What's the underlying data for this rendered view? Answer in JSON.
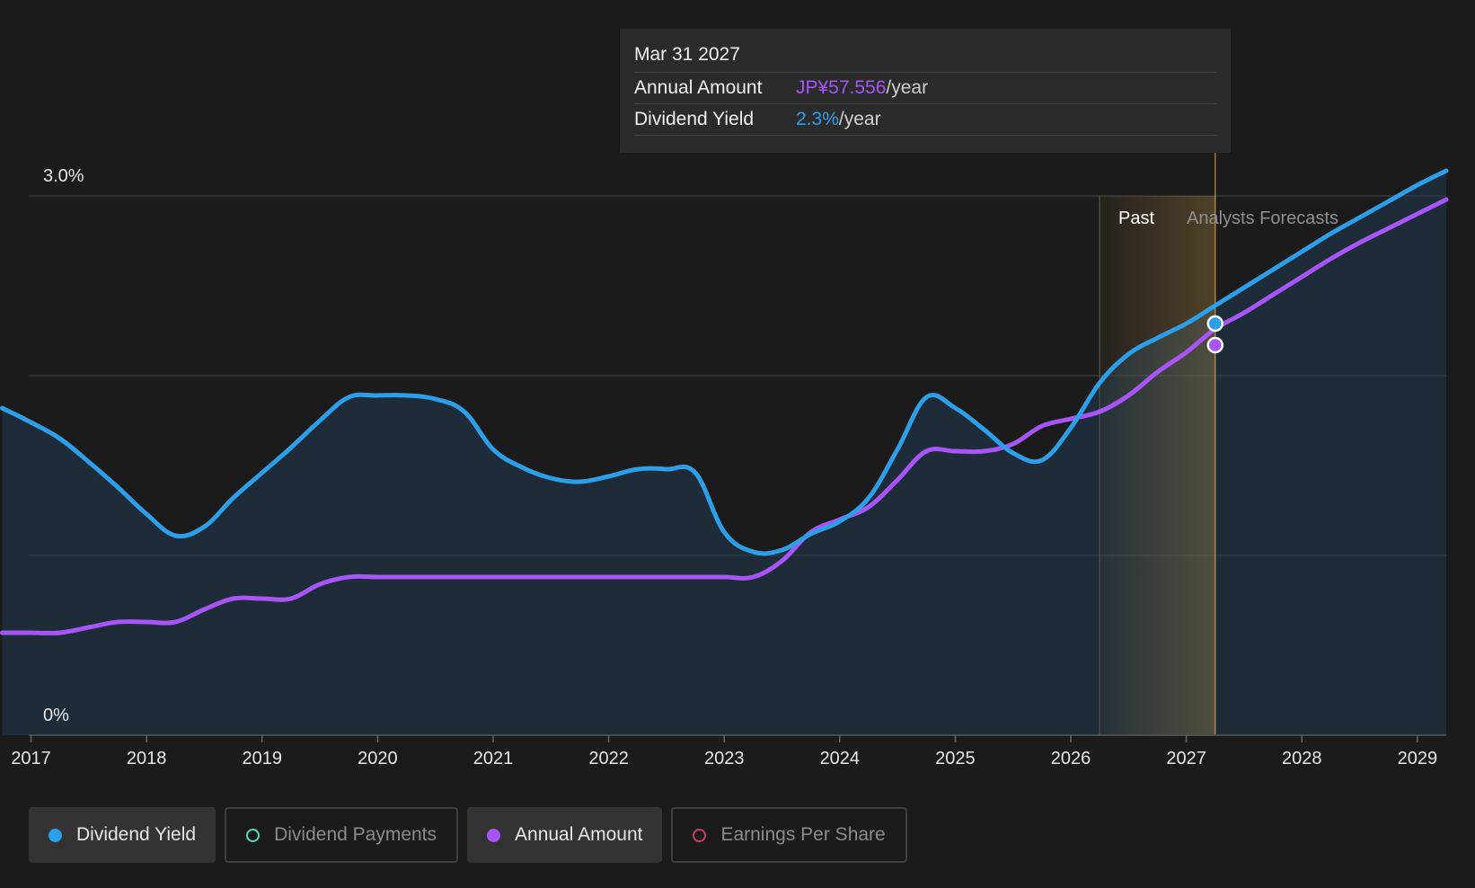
{
  "tooltip": {
    "date": "Mar 31 2027",
    "annual_label": "Annual Amount",
    "annual_value": "JP¥57.556",
    "annual_unit": "/year",
    "yield_label": "Dividend Yield",
    "yield_value": "2.3%",
    "yield_unit": "/year"
  },
  "regions": {
    "past": "Past",
    "forecast": "Analysts Forecasts"
  },
  "legend": [
    {
      "label": "Dividend Yield",
      "color": "#2d9ee8",
      "active": true
    },
    {
      "label": "Dividend Payments",
      "color": "#5ad6c0",
      "active": false
    },
    {
      "label": "Annual Amount",
      "color": "#a855f7",
      "active": true
    },
    {
      "label": "Earnings Per Share",
      "color": "#c2416f",
      "active": false
    }
  ],
  "colors": {
    "yield": "#2d9ee8",
    "amount": "#a855f7",
    "highlight": "#d9a54a",
    "grid": "#3a3a3a"
  },
  "chart_data": {
    "type": "line",
    "title": "",
    "ylabel": "",
    "ylim": [
      0,
      3.0
    ],
    "y_tick_labels": [
      {
        "value": 3.0,
        "label": "3.0%"
      },
      {
        "value": 0,
        "label": "0%"
      }
    ],
    "gridlines": [
      0,
      1.0,
      2.0,
      3.0
    ],
    "xlim": [
      2016.98,
      2029.25
    ],
    "x_ticks": [
      2017,
      2018,
      2019,
      2020,
      2021,
      2022,
      2023,
      2024,
      2025,
      2026,
      2027,
      2028,
      2029
    ],
    "past_start": 2026.25,
    "forecast_start": 2027.25,
    "series": [
      {
        "name": "Dividend Yield",
        "key": "yield",
        "x": [
          2016.75,
          2017.0,
          2017.25,
          2017.5,
          2017.75,
          2018.0,
          2018.25,
          2018.5,
          2018.75,
          2019.0,
          2019.25,
          2019.5,
          2019.75,
          2020.0,
          2020.25,
          2020.5,
          2020.75,
          2021.0,
          2021.25,
          2021.5,
          2021.75,
          2022.0,
          2022.25,
          2022.5,
          2022.75,
          2023.0,
          2023.25,
          2023.5,
          2023.75,
          2024.0,
          2024.25,
          2024.5,
          2024.75,
          2025.0,
          2025.25,
          2025.5,
          2025.75,
          2026.0,
          2026.25,
          2026.5,
          2026.75,
          2027.0,
          2027.25,
          2027.5,
          2027.75,
          2028.0,
          2028.25,
          2028.5,
          2028.75,
          2029.0,
          2029.25
        ],
        "values": [
          1.82,
          1.74,
          1.65,
          1.52,
          1.38,
          1.23,
          1.11,
          1.16,
          1.32,
          1.46,
          1.6,
          1.75,
          1.88,
          1.89,
          1.89,
          1.87,
          1.8,
          1.59,
          1.49,
          1.43,
          1.41,
          1.44,
          1.48,
          1.48,
          1.46,
          1.13,
          1.02,
          1.03,
          1.12,
          1.19,
          1.32,
          1.59,
          1.88,
          1.82,
          1.7,
          1.57,
          1.53,
          1.71,
          1.96,
          2.12,
          2.21,
          2.29,
          2.39,
          2.49,
          2.59,
          2.69,
          2.79,
          2.88,
          2.97,
          3.06,
          3.14
        ]
      },
      {
        "name": "Annual Amount",
        "key": "amount",
        "x": [
          2016.75,
          2017.0,
          2017.25,
          2017.5,
          2017.75,
          2018.0,
          2018.25,
          2018.5,
          2018.75,
          2019.0,
          2019.25,
          2019.5,
          2019.75,
          2020.0,
          2020.25,
          2020.5,
          2020.75,
          2021.0,
          2021.25,
          2021.5,
          2021.75,
          2022.0,
          2022.25,
          2022.5,
          2022.75,
          2023.0,
          2023.25,
          2023.5,
          2023.75,
          2024.0,
          2024.25,
          2024.5,
          2024.75,
          2025.0,
          2025.25,
          2025.5,
          2025.75,
          2026.0,
          2026.25,
          2026.5,
          2026.75,
          2027.0,
          2027.25,
          2027.5,
          2027.75,
          2028.0,
          2028.25,
          2028.5,
          2028.75,
          2029.0,
          2029.25
        ],
        "values": [
          0.57,
          0.57,
          0.57,
          0.6,
          0.63,
          0.63,
          0.63,
          0.7,
          0.76,
          0.76,
          0.76,
          0.84,
          0.88,
          0.88,
          0.88,
          0.88,
          0.88,
          0.88,
          0.88,
          0.88,
          0.88,
          0.88,
          0.88,
          0.88,
          0.88,
          0.88,
          0.88,
          0.97,
          1.13,
          1.2,
          1.27,
          1.42,
          1.58,
          1.58,
          1.58,
          1.62,
          1.72,
          1.76,
          1.8,
          1.89,
          2.02,
          2.13,
          2.26,
          2.35,
          2.45,
          2.55,
          2.65,
          2.74,
          2.82,
          2.9,
          2.98
        ]
      }
    ],
    "highlight_points": [
      {
        "series": "yield",
        "x": 2027.25,
        "value": 2.29
      },
      {
        "series": "amount",
        "x": 2027.25,
        "value": 2.17
      }
    ]
  }
}
